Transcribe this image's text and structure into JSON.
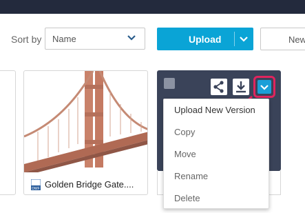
{
  "toolbar": {
    "sort_label": "Sort by",
    "sort_value": "Name",
    "upload_label": "Upload",
    "new_label": "New"
  },
  "files": [
    {
      "name": "Golden Bridge Gate....",
      "type_icon": "dwf-file-icon"
    },
    {
      "name": "",
      "selected": true
    }
  ],
  "context_menu": {
    "items": [
      "Upload New Version",
      "Copy",
      "Move",
      "Rename",
      "Delete"
    ]
  },
  "colors": {
    "topbar": "#232a3d",
    "accent": "#0aa4d6",
    "highlight": "#e0245e",
    "selected_card": "#3a4359"
  }
}
